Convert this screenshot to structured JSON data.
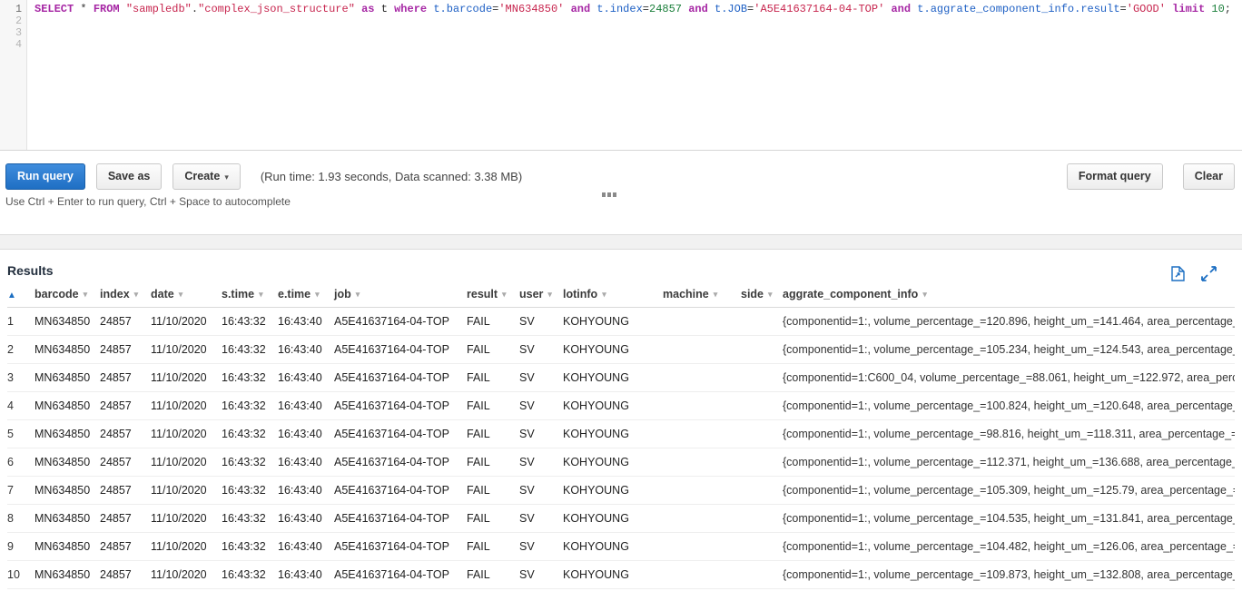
{
  "editor": {
    "line_numbers": [
      "1",
      "2",
      "3",
      "4"
    ],
    "active_line": "1",
    "query_tokens": [
      {
        "t": "SELECT",
        "c": "kw"
      },
      {
        "t": " ",
        "c": "punc"
      },
      {
        "t": "*",
        "c": "punc"
      },
      {
        "t": " ",
        "c": "punc"
      },
      {
        "t": "FROM",
        "c": "kw"
      },
      {
        "t": " ",
        "c": "punc"
      },
      {
        "t": "\"sampledb\"",
        "c": "str"
      },
      {
        "t": ".",
        "c": "punc"
      },
      {
        "t": "\"complex_json_structure\"",
        "c": "str"
      },
      {
        "t": " ",
        "c": "punc"
      },
      {
        "t": "as",
        "c": "kw"
      },
      {
        "t": " ",
        "c": "punc"
      },
      {
        "t": "t",
        "c": "id"
      },
      {
        "t": " ",
        "c": "punc"
      },
      {
        "t": "where",
        "c": "kw"
      },
      {
        "t": " ",
        "c": "punc"
      },
      {
        "t": "t.barcode",
        "c": "col"
      },
      {
        "t": "=",
        "c": "punc"
      },
      {
        "t": "'MN634850'",
        "c": "str"
      },
      {
        "t": " ",
        "c": "punc"
      },
      {
        "t": "and",
        "c": "kw"
      },
      {
        "t": " ",
        "c": "punc"
      },
      {
        "t": "t.index",
        "c": "col"
      },
      {
        "t": "=",
        "c": "punc"
      },
      {
        "t": "24857",
        "c": "num"
      },
      {
        "t": " ",
        "c": "punc"
      },
      {
        "t": "and",
        "c": "kw"
      },
      {
        "t": " ",
        "c": "punc"
      },
      {
        "t": "t.JOB",
        "c": "col"
      },
      {
        "t": "=",
        "c": "punc"
      },
      {
        "t": "'A5E41637164-04-TOP'",
        "c": "str"
      },
      {
        "t": " ",
        "c": "punc"
      },
      {
        "t": "and",
        "c": "kw"
      },
      {
        "t": " ",
        "c": "punc"
      },
      {
        "t": "t.aggrate_component_info.result",
        "c": "col"
      },
      {
        "t": "=",
        "c": "punc"
      },
      {
        "t": "'GOOD'",
        "c": "str"
      },
      {
        "t": " ",
        "c": "punc"
      },
      {
        "t": "limit",
        "c": "kw"
      },
      {
        "t": " ",
        "c": "punc"
      },
      {
        "t": "10",
        "c": "num"
      },
      {
        "t": ";",
        "c": "punc"
      }
    ],
    "query_text": "SELECT * FROM \"sampledb\".\"complex_json_structure\" as t where t.barcode='MN634850' and t.index=24857 and t.JOB='A5E41637164-04-TOP' and t.aggrate_component_info.result='GOOD' limit 10;"
  },
  "toolbar": {
    "run_query_label": "Run query",
    "save_as_label": "Save as",
    "create_label": "Create",
    "create_caret": "⌄",
    "run_info": "(Run time: 1.93 seconds, Data scanned: 3.38 MB)",
    "format_query_label": "Format query",
    "clear_label": "Clear",
    "hint": "Use Ctrl + Enter to run query, Ctrl + Space to autocomplete",
    "accent_color": "#1f6fc4"
  },
  "results": {
    "title": "Results",
    "download_icon": "download-file-icon",
    "expand_icon": "expand-fullscreen-icon",
    "icon_color": "#1b6ec2",
    "sort_indicator": "▲",
    "sort_caret": "▾",
    "columns": [
      {
        "key": "rownum",
        "label": "",
        "cls": "th-rownum"
      },
      {
        "key": "barcode",
        "label": "barcode",
        "cls": "col-barcode"
      },
      {
        "key": "index",
        "label": "index",
        "cls": "col-index"
      },
      {
        "key": "date",
        "label": "date",
        "cls": "col-date"
      },
      {
        "key": "stime",
        "label": "s.time",
        "cls": "col-stime"
      },
      {
        "key": "etime",
        "label": "e.time",
        "cls": "col-etime"
      },
      {
        "key": "job",
        "label": "job",
        "cls": "col-job"
      },
      {
        "key": "result",
        "label": "result",
        "cls": "col-result"
      },
      {
        "key": "user",
        "label": "user",
        "cls": "col-user"
      },
      {
        "key": "lotinfo",
        "label": "lotinfo",
        "cls": "col-lotinfo"
      },
      {
        "key": "machine",
        "label": "machine",
        "cls": "col-machine"
      },
      {
        "key": "side",
        "label": "side",
        "cls": "col-side"
      },
      {
        "key": "aggrate_component_info",
        "label": "aggrate_component_info",
        "cls": "col-json"
      }
    ],
    "rows": [
      {
        "rownum": "1",
        "barcode": "MN634850",
        "index": "24857",
        "date": "11/10/2020",
        "stime": "16:43:32",
        "etime": "16:43:40",
        "job": "A5E41637164-04-TOP",
        "result": "FAIL",
        "user": "SV",
        "lotinfo": "KOHYOUNG",
        "machine": "",
        "side": "",
        "aggrate_component_info": "{componentid=1:, volume_percentage_=120.896, height_um_=141.464, area_percentage_"
      },
      {
        "rownum": "2",
        "barcode": "MN634850",
        "index": "24857",
        "date": "11/10/2020",
        "stime": "16:43:32",
        "etime": "16:43:40",
        "job": "A5E41637164-04-TOP",
        "result": "FAIL",
        "user": "SV",
        "lotinfo": "KOHYOUNG",
        "machine": "",
        "side": "",
        "aggrate_component_info": "{componentid=1:, volume_percentage_=105.234, height_um_=124.543, area_percentage_"
      },
      {
        "rownum": "3",
        "barcode": "MN634850",
        "index": "24857",
        "date": "11/10/2020",
        "stime": "16:43:32",
        "etime": "16:43:40",
        "job": "A5E41637164-04-TOP",
        "result": "FAIL",
        "user": "SV",
        "lotinfo": "KOHYOUNG",
        "machine": "",
        "side": "",
        "aggrate_component_info": "{componentid=1:C600_04, volume_percentage_=88.061, height_um_=122.972, area_perc"
      },
      {
        "rownum": "4",
        "barcode": "MN634850",
        "index": "24857",
        "date": "11/10/2020",
        "stime": "16:43:32",
        "etime": "16:43:40",
        "job": "A5E41637164-04-TOP",
        "result": "FAIL",
        "user": "SV",
        "lotinfo": "KOHYOUNG",
        "machine": "",
        "side": "",
        "aggrate_component_info": "{componentid=1:, volume_percentage_=100.824, height_um_=120.648, area_percentage_"
      },
      {
        "rownum": "5",
        "barcode": "MN634850",
        "index": "24857",
        "date": "11/10/2020",
        "stime": "16:43:32",
        "etime": "16:43:40",
        "job": "A5E41637164-04-TOP",
        "result": "FAIL",
        "user": "SV",
        "lotinfo": "KOHYOUNG",
        "machine": "",
        "side": "",
        "aggrate_component_info": "{componentid=1:, volume_percentage_=98.816, height_um_=118.311, area_percentage_="
      },
      {
        "rownum": "6",
        "barcode": "MN634850",
        "index": "24857",
        "date": "11/10/2020",
        "stime": "16:43:32",
        "etime": "16:43:40",
        "job": "A5E41637164-04-TOP",
        "result": "FAIL",
        "user": "SV",
        "lotinfo": "KOHYOUNG",
        "machine": "",
        "side": "",
        "aggrate_component_info": "{componentid=1:, volume_percentage_=112.371, height_um_=136.688, area_percentage_"
      },
      {
        "rownum": "7",
        "barcode": "MN634850",
        "index": "24857",
        "date": "11/10/2020",
        "stime": "16:43:32",
        "etime": "16:43:40",
        "job": "A5E41637164-04-TOP",
        "result": "FAIL",
        "user": "SV",
        "lotinfo": "KOHYOUNG",
        "machine": "",
        "side": "",
        "aggrate_component_info": "{componentid=1:, volume_percentage_=105.309, height_um_=125.79, area_percentage_="
      },
      {
        "rownum": "8",
        "barcode": "MN634850",
        "index": "24857",
        "date": "11/10/2020",
        "stime": "16:43:32",
        "etime": "16:43:40",
        "job": "A5E41637164-04-TOP",
        "result": "FAIL",
        "user": "SV",
        "lotinfo": "KOHYOUNG",
        "machine": "",
        "side": "",
        "aggrate_component_info": "{componentid=1:, volume_percentage_=104.535, height_um_=131.841, area_percentage_"
      },
      {
        "rownum": "9",
        "barcode": "MN634850",
        "index": "24857",
        "date": "11/10/2020",
        "stime": "16:43:32",
        "etime": "16:43:40",
        "job": "A5E41637164-04-TOP",
        "result": "FAIL",
        "user": "SV",
        "lotinfo": "KOHYOUNG",
        "machine": "",
        "side": "",
        "aggrate_component_info": "{componentid=1:, volume_percentage_=104.482, height_um_=126.06, area_percentage_="
      },
      {
        "rownum": "10",
        "barcode": "MN634850",
        "index": "24857",
        "date": "11/10/2020",
        "stime": "16:43:32",
        "etime": "16:43:40",
        "job": "A5E41637164-04-TOP",
        "result": "FAIL",
        "user": "SV",
        "lotinfo": "KOHYOUNG",
        "machine": "",
        "side": "",
        "aggrate_component_info": "{componentid=1:, volume_percentage_=109.873, height_um_=132.808, area_percentage_"
      }
    ]
  }
}
